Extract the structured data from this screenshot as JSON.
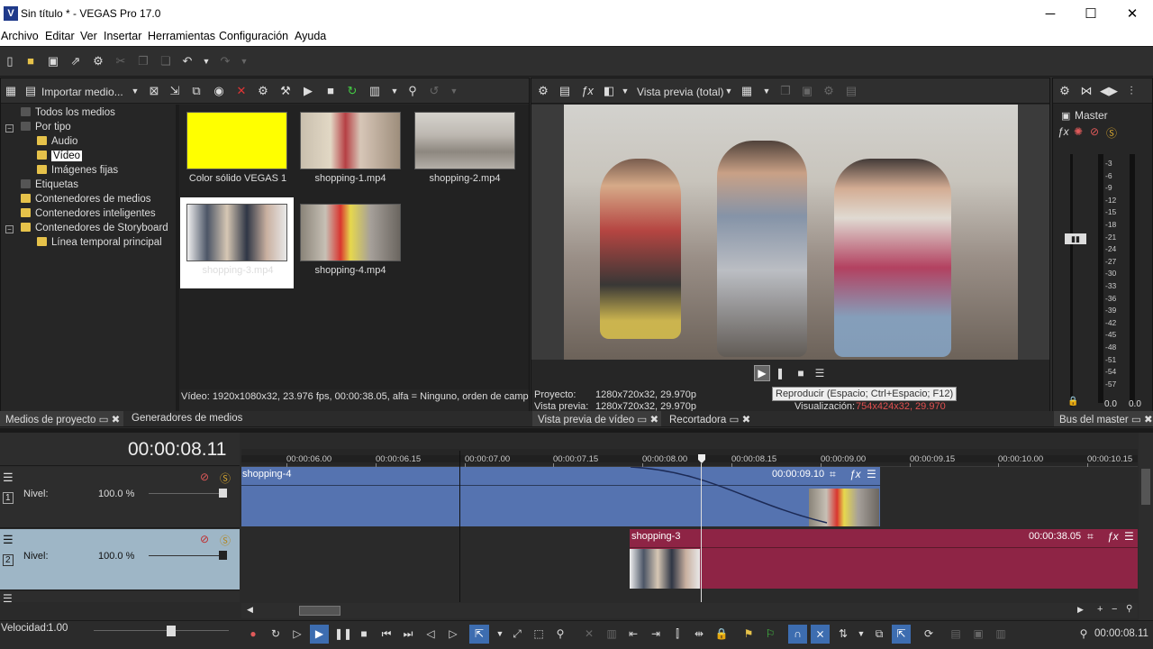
{
  "window": {
    "title": "Sin título * - VEGAS Pro 17.0",
    "app_icon": "V",
    "minimize": "─",
    "maximize": "☐",
    "close": "✕"
  },
  "menu": [
    "Archivo",
    "Editar",
    "Ver",
    "Insertar",
    "Herramientas",
    "Configuración",
    "Ayuda"
  ],
  "explorer": {
    "import_label": "Importar medio...",
    "tree": [
      {
        "label": "Todos los medios",
        "level": 0
      },
      {
        "label": "Por tipo",
        "level": 0
      },
      {
        "label": "Audio",
        "level": 1
      },
      {
        "label": "Vídeo",
        "level": 1,
        "selected": true
      },
      {
        "label": "Imágenes fijas",
        "level": 1
      },
      {
        "label": "Etiquetas",
        "level": 0
      },
      {
        "label": "Contenedores de medios",
        "level": 0
      },
      {
        "label": "Contenedores inteligentes",
        "level": 0
      },
      {
        "label": "Contenedores de Storyboard",
        "level": 0
      },
      {
        "label": "Línea temporal principal",
        "level": 1
      }
    ],
    "media": [
      {
        "label": "Color sólido VEGAS 1",
        "color": "#ffff00"
      },
      {
        "label": "shopping-1.mp4"
      },
      {
        "label": "shopping-2.mp4"
      },
      {
        "label": "shopping-3.mp4",
        "selected": true
      },
      {
        "label": "shopping-4.mp4"
      }
    ],
    "status": "Vídeo: 1920x1080x32, 23.976 fps, 00:00:38.05, alfa = Ninguno, orden de campo"
  },
  "tabs_left": {
    "project_media": "Medios de proyecto",
    "media_generators": "Generadores de medios"
  },
  "preview": {
    "mode": "Vista previa (total)",
    "project_label": "Proyecto:",
    "project_value": "1280x720x32, 29.970p",
    "preview_label": "Vista previa:",
    "preview_value": "1280x720x32, 29.970p",
    "display_label": "Visualización:",
    "display_value": "754x424x32, 29.970",
    "tooltip": "Reproducir (Espacio; Ctrl+Espacio; F12)",
    "tab_preview": "Vista previa de vídeo",
    "tab_trimmer": "Recortadora"
  },
  "master": {
    "label": "Master",
    "tab": "Bus del master",
    "db_left": "0.0",
    "db_right": "0.0",
    "scale": [
      "3",
      "6",
      "9",
      "12",
      "15",
      "18",
      "21",
      "24",
      "27",
      "30",
      "33",
      "36",
      "39",
      "42",
      "45",
      "48",
      "51",
      "54",
      "57"
    ]
  },
  "timeline": {
    "timecode": "00:00:08.11",
    "ruler": [
      "00:00:06.00",
      "00:00:06.15",
      "00:00:07.00",
      "00:00:07.15",
      "00:00:08.00",
      "00:00:08.15",
      "00:00:09.00",
      "00:00:09.15",
      "00:00:10.00",
      "00:00:10.15"
    ],
    "tracks": [
      {
        "number": "1",
        "level_label": "Nivel:",
        "level_value": "100.0 %"
      },
      {
        "number": "2",
        "level_label": "Nivel:",
        "level_value": "100.0 %"
      }
    ],
    "clips": [
      {
        "name": "shopping-4",
        "time": "00:00:09.10",
        "color": "#5573b0"
      },
      {
        "name": "shopping-3",
        "time": "00:00:38.05",
        "color": "#8e2445"
      }
    ]
  },
  "transport": {
    "speed_label": "Velocidad:",
    "speed_value": "1.00",
    "timecode": "00:00:08.11"
  }
}
